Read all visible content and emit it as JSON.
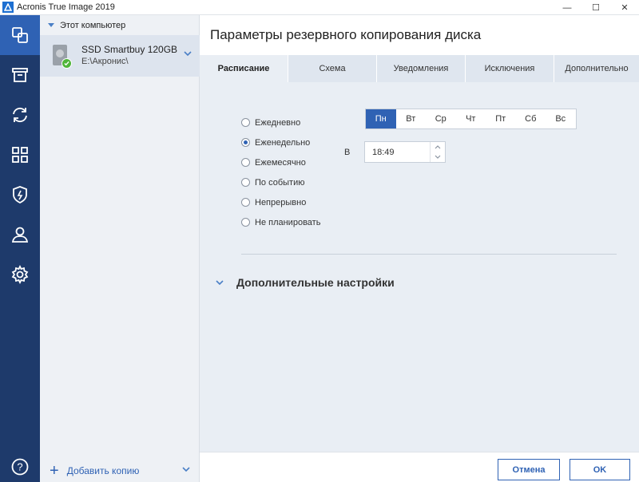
{
  "window": {
    "title": "Acronis True Image 2019",
    "minimize": "—",
    "maximize": "☐",
    "close": "✕"
  },
  "rail": {
    "items": [
      {
        "icon": "backup-icon",
        "active": true
      },
      {
        "icon": "archive-icon"
      },
      {
        "icon": "sync-icon"
      },
      {
        "icon": "tools-icon"
      },
      {
        "icon": "active-protection-icon"
      },
      {
        "icon": "account-icon"
      },
      {
        "icon": "settings-icon"
      },
      {
        "icon": "help-icon"
      }
    ],
    "help_glyph": "?"
  },
  "sidebar": {
    "group_label": "Этот компьютер",
    "item": {
      "name": "SSD Smartbuy 120GB",
      "path": "E:\\Акронис\\"
    },
    "add_label": "Добавить копию"
  },
  "main": {
    "title": "Параметры резервного копирования диска",
    "tabs": [
      "Расписание",
      "Схема",
      "Уведомления",
      "Исключения",
      "Дополнительно"
    ],
    "active_tab": "Расписание",
    "schedule_options": [
      "Ежедневно",
      "Еженедельно",
      "Ежемесячно",
      "По событию",
      "Непрерывно",
      "Не планировать"
    ],
    "selected_option": "Еженедельно",
    "days": [
      "Пн",
      "Вт",
      "Ср",
      "Чт",
      "Пт",
      "Сб",
      "Вс"
    ],
    "selected_day": "Пн",
    "time_label": "В",
    "time_value": "18:49",
    "advanced_label": "Дополнительные настройки"
  },
  "footer": {
    "cancel_label": "Отмена",
    "ok_label": "OK"
  },
  "colors": {
    "accent": "#2f62b4",
    "rail": "#1e3a6b",
    "success": "#4fb53a"
  }
}
